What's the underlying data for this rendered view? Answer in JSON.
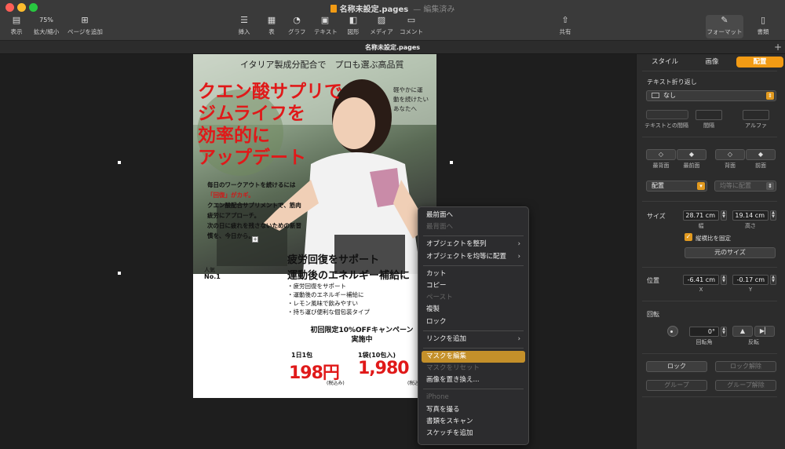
{
  "window": {
    "title": "名称未設定.pages",
    "title_status": "— 編集済み"
  },
  "toolbar": {
    "view": "表示",
    "zoom_value": "75%",
    "zoom": "拡大/縮小",
    "add_page": "ページを追加",
    "insert": "挿入",
    "table": "表",
    "chart": "グラフ",
    "text": "テキスト",
    "shape": "図形",
    "media": "メディア",
    "comment": "コメント",
    "share": "共有",
    "format": "フォーマット",
    "document": "書類"
  },
  "tab": {
    "name": "名称未設定.pages"
  },
  "document": {
    "header": "イタリア製成分配合で　プロも選ぶ高品質",
    "catch_lines": [
      "クエン酸サプリで",
      "ジムライフを",
      "効率的に",
      "アップデート"
    ],
    "side_lines": [
      "軽やかに運",
      "動を続けたい",
      "あなたへ"
    ],
    "body_lines": [
      "毎日のワークアウトを続けるには",
      "「回復」がカギ。",
      "クエン酸配合サプリメントで、筋肉",
      "疲労にアプローチ。",
      "次の日に疲れを残さないための新習",
      "慣を、今日から。"
    ],
    "section_title_1": "疲労回復をサポート",
    "section_title_2": "運動後のエネルギー補給に",
    "ninki": "人気",
    "no1": "No.1",
    "bullets": [
      "・疲労回復をサポート",
      "・運動後のエネルギー補給に",
      "・レモン風味で飲みやすい",
      "・持ち運び便利な個包装タイプ"
    ],
    "campaign_1": "初回限定10%OFFキャンペーン",
    "campaign_2": "実施中",
    "price1_label": "1日1包",
    "price1": "198円",
    "price1_tax": "(税込み)",
    "price2_label": "1袋(10包入)",
    "price2": "1,980",
    "price2_tax": "(税込"
  },
  "context_menu": {
    "items": [
      {
        "label": "最前面へ",
        "enabled": true
      },
      {
        "label": "最背面へ",
        "enabled": false
      },
      {
        "sep": true
      },
      {
        "label": "オブジェクトを整列",
        "enabled": true,
        "submenu": true
      },
      {
        "label": "オブジェクトを均等に配置",
        "enabled": true,
        "submenu": true
      },
      {
        "sep": true
      },
      {
        "label": "カット",
        "enabled": true
      },
      {
        "label": "コピー",
        "enabled": true
      },
      {
        "label": "ペースト",
        "enabled": false
      },
      {
        "label": "複製",
        "enabled": true
      },
      {
        "label": "ロック",
        "enabled": true
      },
      {
        "sep": true
      },
      {
        "label": "リンクを追加",
        "enabled": true,
        "submenu": true
      },
      {
        "sep": true
      },
      {
        "label": "マスクを編集",
        "enabled": true,
        "selected": true
      },
      {
        "label": "マスクをリセット",
        "enabled": false
      },
      {
        "label": "画像を置き換え...",
        "enabled": true
      },
      {
        "sep": true
      },
      {
        "label": "iPhone",
        "enabled": false
      },
      {
        "label": "写真を撮る",
        "enabled": true
      },
      {
        "label": "書類をスキャン",
        "enabled": true
      },
      {
        "label": "スケッチを追加",
        "enabled": true
      }
    ]
  },
  "inspector": {
    "tabs": [
      "スタイル",
      "画像",
      "配置"
    ],
    "active_tab": "配置",
    "text_wrap_label": "テキスト折り返し",
    "text_wrap_value": "なし",
    "text_fit": "テキストとの間隔",
    "spacing": "間隔",
    "alpha": "アルファ",
    "back": "最背面",
    "front": "最前面",
    "backward": "背面",
    "forward": "前面",
    "align": "配置",
    "distribute": "均等に配置",
    "size": "サイズ",
    "width_value": "28.71 cm",
    "height_value": "19.14 cm",
    "width_label": "幅",
    "height_label": "高さ",
    "constrain": "縦横比を固定",
    "original_size": "元のサイズ",
    "position": "位置",
    "x_value": "-6.41 cm",
    "y_value": "-0.17 cm",
    "x_label": "X",
    "y_label": "Y",
    "rotate": "回転",
    "angle_value": "0°",
    "angle_label": "回転角",
    "flip_label": "反転",
    "lock": "ロック",
    "unlock": "ロック解除",
    "group": "グループ",
    "ungroup": "グループ解除"
  },
  "colors": {
    "accent": "#f29b14",
    "menu_highlight": "#c4902a",
    "price_red": "#e01919"
  }
}
